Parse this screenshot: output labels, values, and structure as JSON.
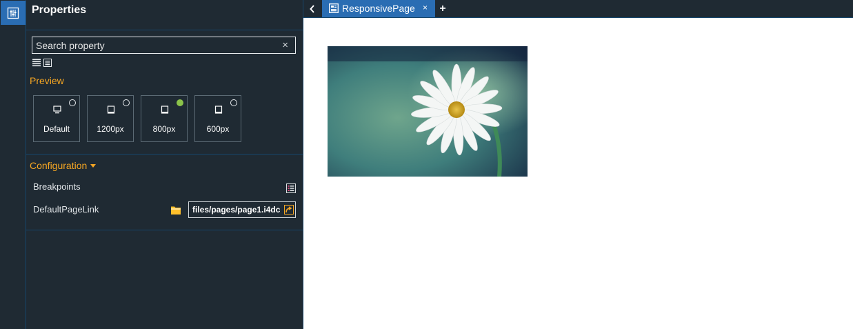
{
  "panel": {
    "title": "Properties",
    "search": {
      "placeholder": "Search property",
      "value": "",
      "clear": "×"
    },
    "preview": {
      "label": "Preview",
      "options": [
        {
          "label": "Default",
          "selected": false
        },
        {
          "label": "1200px",
          "selected": false
        },
        {
          "label": "800px",
          "selected": true
        },
        {
          "label": "600px",
          "selected": false
        }
      ]
    },
    "configuration": {
      "label": "Configuration",
      "breakpoints_label": "Breakpoints",
      "default_page_link_label": "DefaultPageLink",
      "default_page_link_value": "files/pages/page1.i4dc"
    }
  },
  "tabs": {
    "active": {
      "label": "ResponsivePage",
      "close": "×"
    },
    "add": "+"
  },
  "colors": {
    "accent": "#2a6db3",
    "panel_bg": "#1f2a33",
    "section": "#f5a623",
    "selected_radio": "#8bc34a"
  },
  "icons": [
    "properties-icon",
    "list-view-icon",
    "detail-view-icon",
    "monitor-icon",
    "tablet-icon",
    "caret-down-icon",
    "breakpoints-list-icon",
    "folder-icon",
    "open-link-icon",
    "chevron-left-icon",
    "page-icon",
    "close-icon",
    "plus-icon"
  ]
}
